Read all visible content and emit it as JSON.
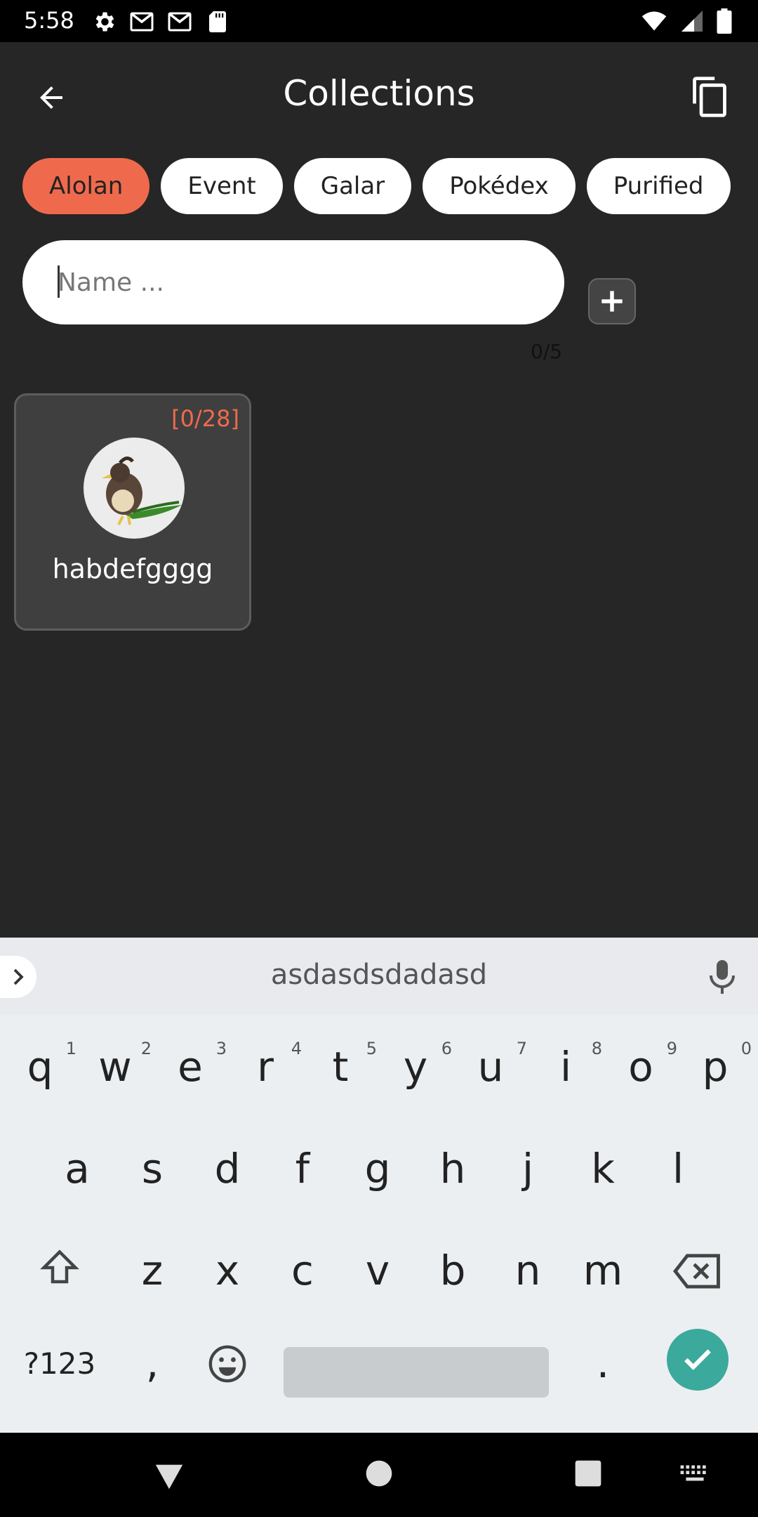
{
  "status_bar": {
    "time": "5:58",
    "left_icons": [
      "settings-icon",
      "gmail-icon",
      "gmail-icon",
      "sd-card-icon"
    ],
    "right_icons": [
      "wifi-icon",
      "signal-icon",
      "battery-icon"
    ]
  },
  "appbar": {
    "title": "Collections",
    "back_icon": "arrow-back-icon",
    "copy_icon": "copy-icon"
  },
  "chips": {
    "items": [
      "Alolan",
      "Event",
      "Galar",
      "Pokédex",
      "Purified"
    ],
    "active_index": 0,
    "active_color": "#ef6a4d"
  },
  "name_input": {
    "value": "",
    "placeholder": "Name ...",
    "counter": "0/5"
  },
  "collections": [
    {
      "name": "habdefgggg",
      "count": "[0/28]"
    }
  ],
  "keyboard": {
    "suggestion": "asdasdsdadasd",
    "row1": [
      "q",
      "w",
      "e",
      "r",
      "t",
      "y",
      "u",
      "i",
      "o",
      "p"
    ],
    "row1_hints": [
      "1",
      "2",
      "3",
      "4",
      "5",
      "6",
      "7",
      "8",
      "9",
      "0"
    ],
    "row2": [
      "a",
      "s",
      "d",
      "f",
      "g",
      "h",
      "j",
      "k",
      "l"
    ],
    "row3": [
      "z",
      "x",
      "c",
      "v",
      "b",
      "n",
      "m"
    ],
    "symbols_label": "?123",
    "comma": ",",
    "period": ".",
    "enter_color": "#3ba99c"
  },
  "colors": {
    "background": "#262626",
    "accent": "#ef6a4d"
  }
}
